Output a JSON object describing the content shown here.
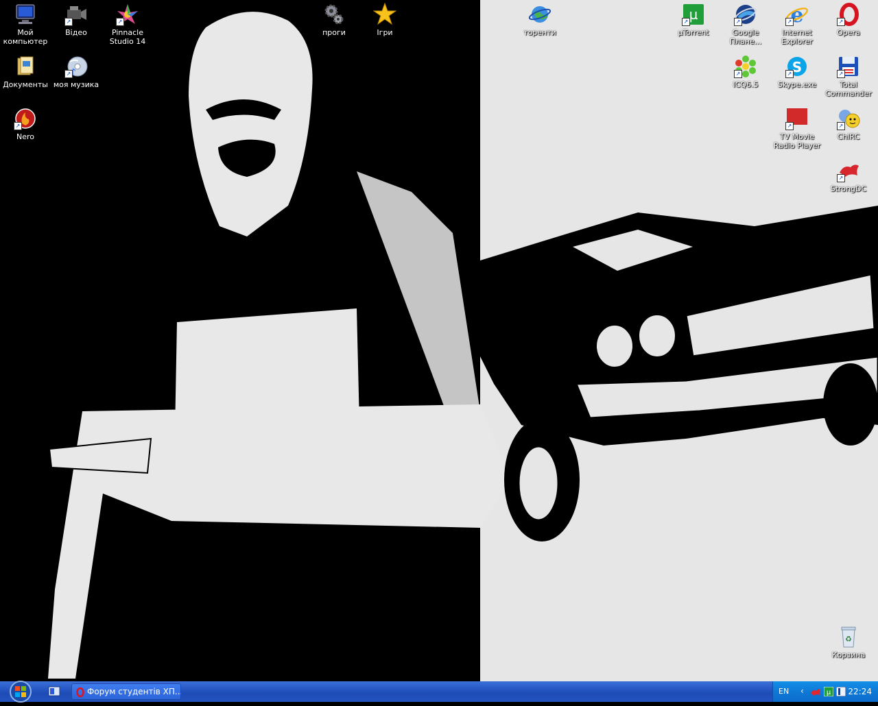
{
  "desktop_icons": {
    "my_computer": {
      "label": "Мой компьютер",
      "icon": "monitor-icon"
    },
    "video": {
      "label": "Відео",
      "icon": "video-camera-icon"
    },
    "pinnacle": {
      "label": "Pinnacle Studio 14",
      "icon": "pinnacle-icon"
    },
    "progy": {
      "label": "проги",
      "icon": "gears-icon"
    },
    "igry": {
      "label": "Ігри",
      "icon": "star-icon"
    },
    "torrents": {
      "label": "торенти",
      "icon": "globe-icon"
    },
    "utorrent": {
      "label": "µTorrent",
      "icon": "utorrent-icon"
    },
    "google_earth": {
      "label": "Google Плане...",
      "icon": "google-earth-icon"
    },
    "ie": {
      "label": "Internet Explorer",
      "icon": "ie-icon"
    },
    "opera": {
      "label": "Opera",
      "icon": "opera-icon"
    },
    "documents": {
      "label": "Документы",
      "icon": "documents-icon"
    },
    "my_music": {
      "label": "моя музика",
      "icon": "music-cd-icon"
    },
    "icq": {
      "label": "ICQ6.5",
      "icon": "icq-flower-icon"
    },
    "skype": {
      "label": "Skype.exe",
      "icon": "skype-icon"
    },
    "total_commander": {
      "label": "Total Commander",
      "icon": "floppy-icon"
    },
    "nero": {
      "label": "Nero",
      "icon": "nero-icon"
    },
    "tv_movie": {
      "label": "TV Movie Radio Player",
      "icon": "tv-icon"
    },
    "chirc": {
      "label": "ChIRC",
      "icon": "chirc-icon"
    },
    "strongdc": {
      "label": "StrongDC",
      "icon": "strongdc-icon"
    },
    "recycle_bin": {
      "label": "Корзина",
      "icon": "recycle-bin-icon"
    }
  },
  "taskbar": {
    "task_forum_label": "Форум студентів ХП...",
    "language": "EN",
    "clock": "22:24"
  },
  "colors": {
    "taskbar": "#2453c1",
    "tray": "#0f79d6",
    "wallpaper_dark": "#000000",
    "wallpaper_light": "#e6e6e6"
  }
}
